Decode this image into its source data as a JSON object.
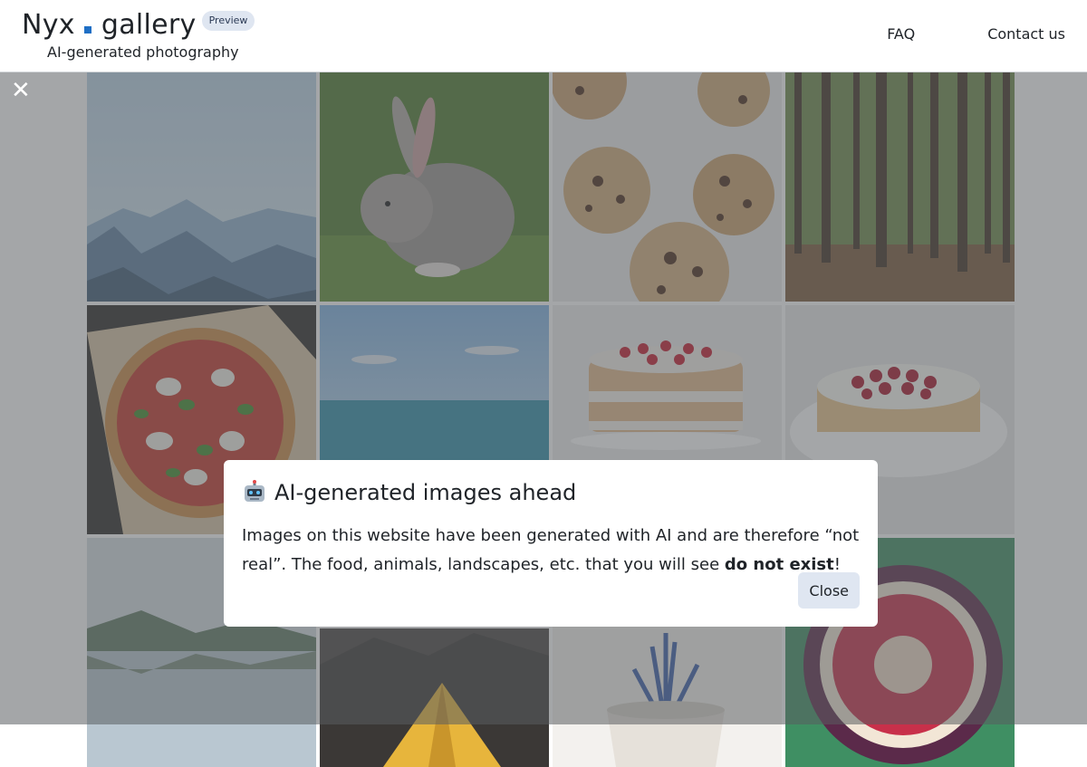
{
  "header": {
    "logo_left": "Nyx",
    "logo_right": "gallery",
    "badge": "Preview",
    "tagline": "AI-generated photography",
    "nav": [
      "FAQ",
      "Contact us"
    ]
  },
  "overlay": {
    "close_symbol": "✕"
  },
  "gallery": {
    "tiles": [
      {
        "subject": "mountain-landscape"
      },
      {
        "subject": "rabbit"
      },
      {
        "subject": "chocolate-chip-cookies"
      },
      {
        "subject": "forest"
      },
      {
        "subject": "pizza"
      },
      {
        "subject": "ocean"
      },
      {
        "subject": "layer-cake"
      },
      {
        "subject": "raspberry-tart"
      },
      {
        "subject": "lake-reflection"
      },
      {
        "subject": "tent"
      },
      {
        "subject": "potted-plant"
      },
      {
        "subject": "fig"
      }
    ]
  },
  "modal": {
    "icon": "robot-icon",
    "title": "AI-generated images ahead",
    "body_part1": "Images on this website have been generated with AI and are therefore “not real”. The food, animals, landscapes, etc. that you will see ",
    "body_bold": "do not exist",
    "body_part2": "!",
    "close_label": "Close"
  },
  "colors": {
    "accent_dot": "#1f6fc5",
    "badge_bg": "#dfe6f1",
    "overlay_tint": "#5a5c60"
  }
}
